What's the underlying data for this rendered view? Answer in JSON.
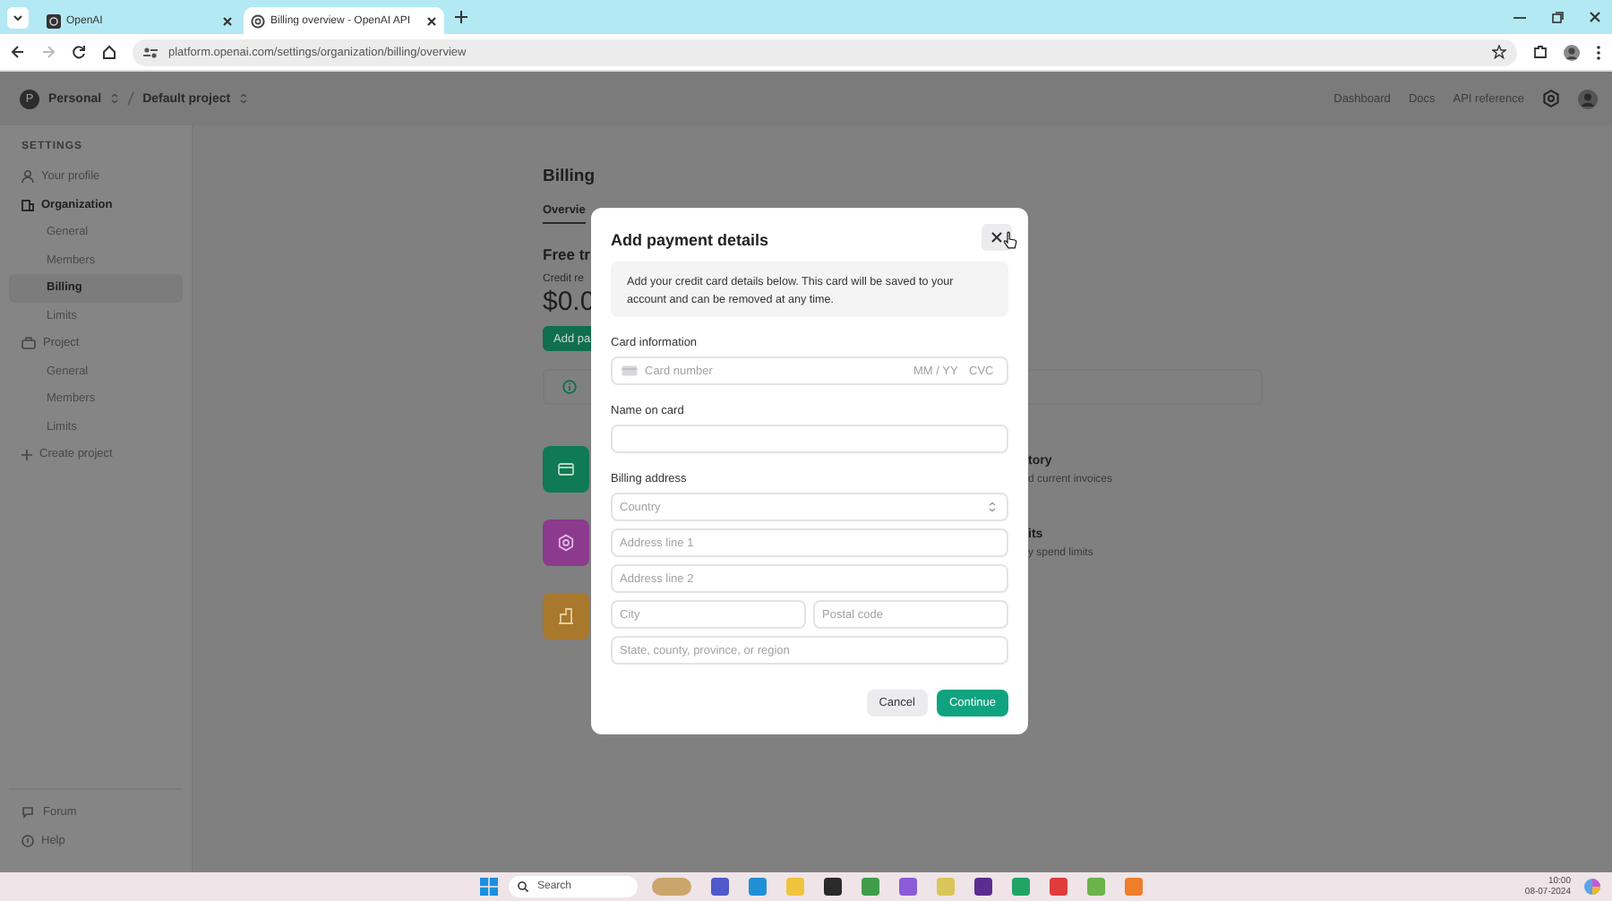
{
  "browser": {
    "tabs": [
      {
        "title": "OpenAI",
        "selected": false
      },
      {
        "title": "Billing overview - OpenAI API",
        "selected": true
      }
    ],
    "url": "platform.openai.com/settings/organization/billing/overview"
  },
  "header": {
    "avatar_letter": "P",
    "breadcrumb": [
      "Personal",
      "Default project"
    ],
    "links": [
      "Dashboard",
      "Docs",
      "API reference"
    ]
  },
  "sidebar": {
    "heading": "SETTINGS",
    "items": [
      {
        "label": "Your profile",
        "kind": "profile",
        "current": false
      },
      {
        "label": "Organization",
        "kind": "organization",
        "current": true,
        "children": [
          {
            "label": "General",
            "selected": false
          },
          {
            "label": "Members",
            "selected": false
          },
          {
            "label": "Billing",
            "selected": true
          },
          {
            "label": "Limits",
            "selected": false
          }
        ]
      },
      {
        "label": "Project",
        "kind": "project",
        "current": false,
        "children": [
          {
            "label": "General",
            "selected": false
          },
          {
            "label": "Members",
            "selected": false
          },
          {
            "label": "Limits",
            "selected": false
          }
        ]
      },
      {
        "label": "Create project",
        "kind": "create",
        "current": false
      }
    ],
    "footer": [
      {
        "label": "Forum",
        "kind": "forum"
      },
      {
        "label": "Help",
        "kind": "help"
      }
    ]
  },
  "main": {
    "title": "Billing",
    "tab": "Overvie",
    "heading": "Free tr",
    "credit_label": "Credit re",
    "credit_value": "$0.0",
    "button": "Add pa",
    "cards": [
      {
        "kind": "card",
        "color": "#0f7a55",
        "title": "tory",
        "description": "d current invoices"
      },
      {
        "kind": "gear",
        "color": "#8c3a8e",
        "title": "its",
        "description": "y spend limits"
      },
      {
        "kind": "building",
        "color": "#a8782c"
      }
    ]
  },
  "modal": {
    "title": "Add payment details",
    "notice": "Add your credit card details below. This card will be saved to your account and can be removed at any time.",
    "card_section": {
      "label": "Card information",
      "fields": [
        {
          "kind": "number",
          "placeholder": "Card number"
        },
        {
          "kind": "expiry",
          "placeholder": "MM / YY"
        },
        {
          "kind": "cvc",
          "placeholder": "CVC"
        }
      ]
    },
    "name_section": {
      "label": "Name on card"
    },
    "address_section": {
      "label": "Billing address",
      "fields": [
        {
          "kind": "select",
          "placeholder": "Country"
        },
        {
          "kind": "text",
          "placeholder": "Address line 1"
        },
        {
          "kind": "text",
          "placeholder": "Address line 2"
        },
        {
          "kind": "half",
          "placeholder": "City"
        },
        {
          "kind": "half",
          "placeholder": "Postal code"
        },
        {
          "kind": "text",
          "placeholder": "State, county, province, or region"
        }
      ]
    },
    "buttons": [
      {
        "label": "Cancel",
        "kind": "secondary"
      },
      {
        "label": "Continue",
        "kind": "primary"
      }
    ]
  },
  "taskbar": {
    "search": "Search",
    "apps": [
      {
        "color": "#c9a66b"
      },
      {
        "color": "#5059c9"
      },
      {
        "color": "#1f8fd6"
      },
      {
        "color": "#f0c33c"
      },
      {
        "color": "#2a2a2a"
      },
      {
        "color": "#3f9d4a"
      },
      {
        "color": "#8c5bd8"
      },
      {
        "color": "#d9c65a"
      },
      {
        "color": "#5b2d90"
      },
      {
        "color": "#21a366"
      },
      {
        "color": "#e03c3c"
      },
      {
        "color": "#6bb34a"
      },
      {
        "color": "#ef7d2b"
      }
    ],
    "time": "10:00",
    "date": "08-07-2024"
  }
}
